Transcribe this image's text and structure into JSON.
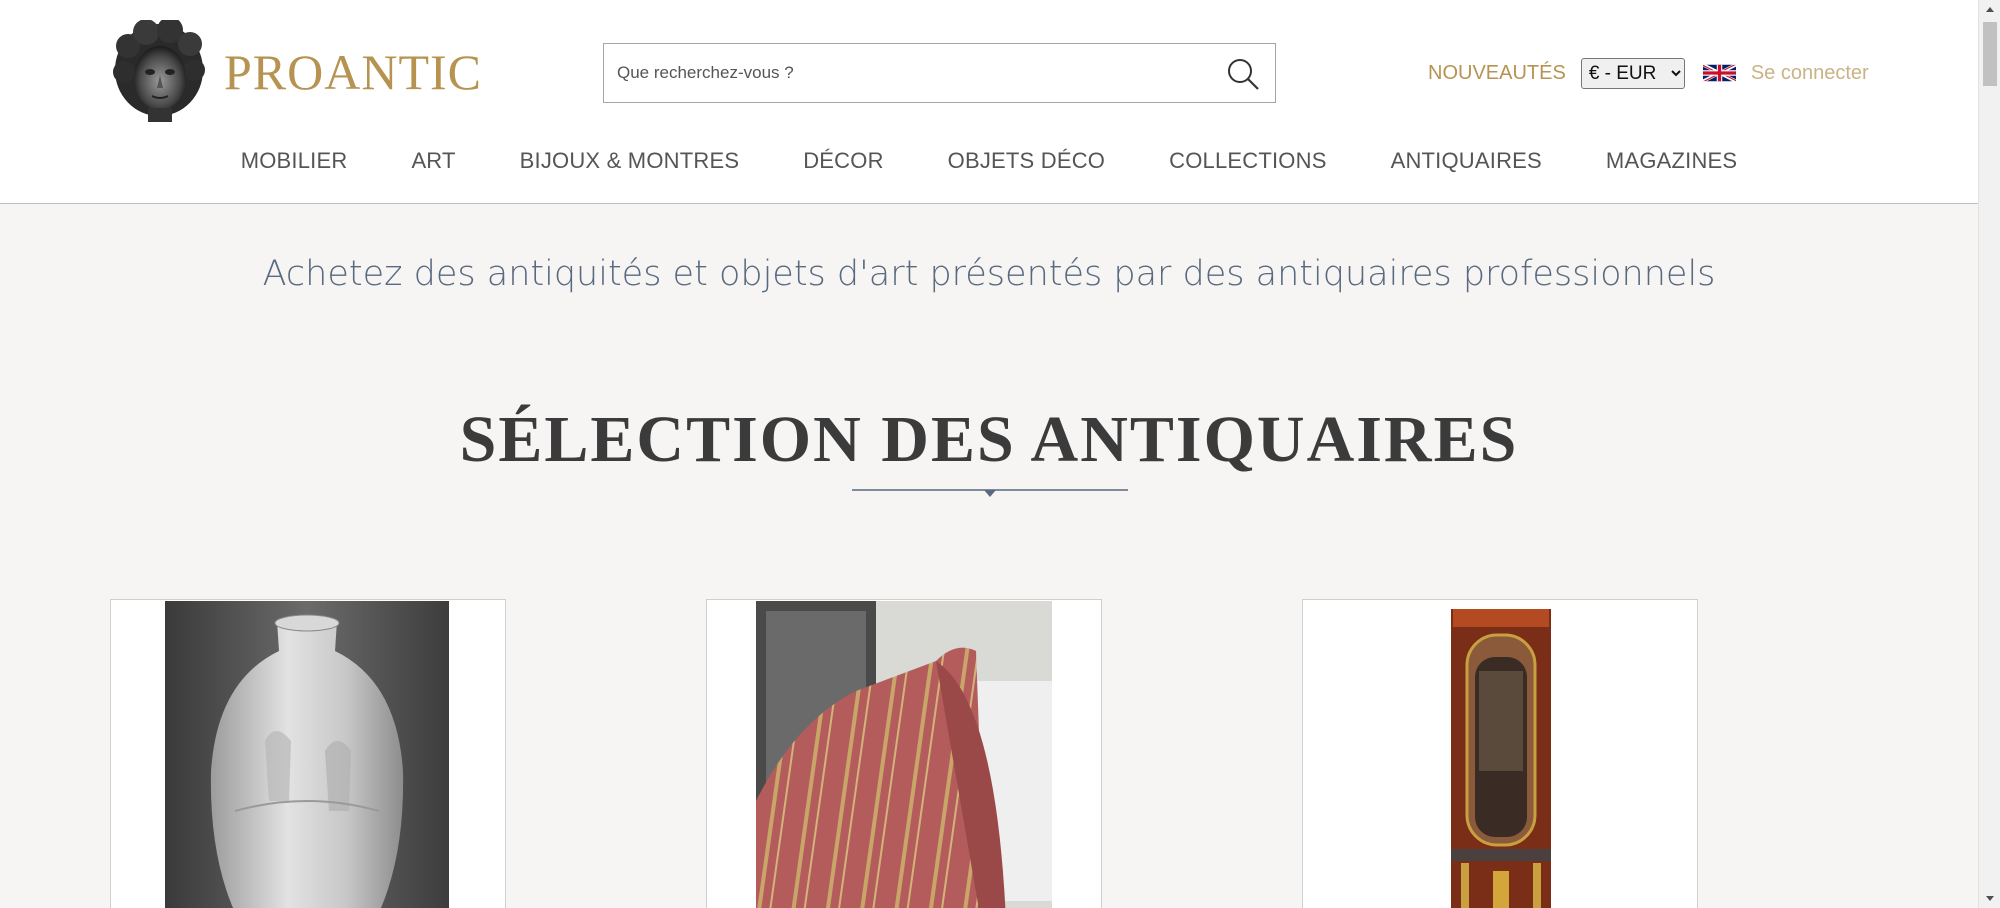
{
  "header": {
    "logo_text": "PROANTIC",
    "search_placeholder": "Que recherchez-vous ?",
    "news_label": "NOUVEAUTÉS",
    "currency_selected": "€ - EUR",
    "login_label": "Se connecter"
  },
  "nav": {
    "items": [
      {
        "label": "MOBILIER"
      },
      {
        "label": "ART"
      },
      {
        "label": "BIJOUX & MONTRES"
      },
      {
        "label": "DÉCOR"
      },
      {
        "label": "OBJETS DÉCO"
      },
      {
        "label": "COLLECTIONS"
      },
      {
        "label": "ANTIQUAIRES"
      },
      {
        "label": "MAGAZINES"
      }
    ]
  },
  "main": {
    "tagline": "Achetez des antiquités et objets d'art présentés par des antiquaires professionnels",
    "selection_title": "SÉLECTION DES ANTIQUAIRES"
  },
  "products": [
    {
      "image": "frosted-glass-vase-image"
    },
    {
      "image": "striped-silk-fabric-image"
    },
    {
      "image": "mahogany-mirror-console-image"
    }
  ],
  "colors": {
    "gold": "#b69351",
    "gold_light": "#c9b385",
    "slate_blue": "#596a80",
    "background": "#f6f5f3"
  },
  "icons": [
    "search-icon",
    "uk-flag-icon",
    "chevron-down-icon",
    "logo-bust-icon"
  ]
}
